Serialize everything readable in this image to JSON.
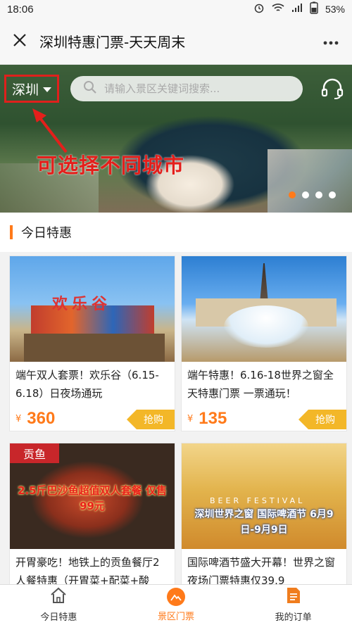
{
  "status_bar": {
    "time": "18:06",
    "battery": "53%"
  },
  "title_bar": {
    "title": "深圳特惠门票-天天周末"
  },
  "banner": {
    "city": "深圳",
    "search_placeholder": "请输入景区关键词搜索...",
    "annotation": "可选择不同城市",
    "active_slide": 1,
    "slide_count": 4
  },
  "section": {
    "title": "今日特惠"
  },
  "products": [
    {
      "name": "端午双人套票！欢乐谷（6.15-6.18）日夜场通玩",
      "currency": "¥",
      "price": "360",
      "buy_label": "抢购",
      "image_text": "欢乐谷"
    },
    {
      "name": "端午特惠！6.16-18世界之窗全天特惠门票 一票通玩！",
      "currency": "¥",
      "price": "135",
      "buy_label": "抢购",
      "image_text": ""
    },
    {
      "name": "开胃豪吃！地铁上的贡鱼餐厅2人餐特惠（开胃菜+配菜+酸",
      "currency": "¥",
      "price": "",
      "buy_label": "",
      "image_text": "2.5斤巴沙鱼超值双人套餐 仅售99元",
      "image_logo": "贡鱼"
    },
    {
      "name": "国际啤酒节盛大开幕！世界之窗夜场门票特惠仅39.9",
      "currency": "¥",
      "price": "",
      "buy_label": "",
      "image_text": "深圳世界之窗 国际啤酒节 6月9日-9月9日",
      "image_banner_en": "BEER FESTIVAL"
    }
  ],
  "bottom_nav": [
    {
      "label": "今日特惠",
      "icon": "home-icon",
      "active": false
    },
    {
      "label": "景区门票",
      "icon": "mountain-icon",
      "active": true
    },
    {
      "label": "我的订单",
      "icon": "order-list-icon",
      "active": false
    }
  ],
  "colors": {
    "accent": "#ff7a1a",
    "buy_button": "#f3b728",
    "annotation_red": "#e41f1b"
  }
}
